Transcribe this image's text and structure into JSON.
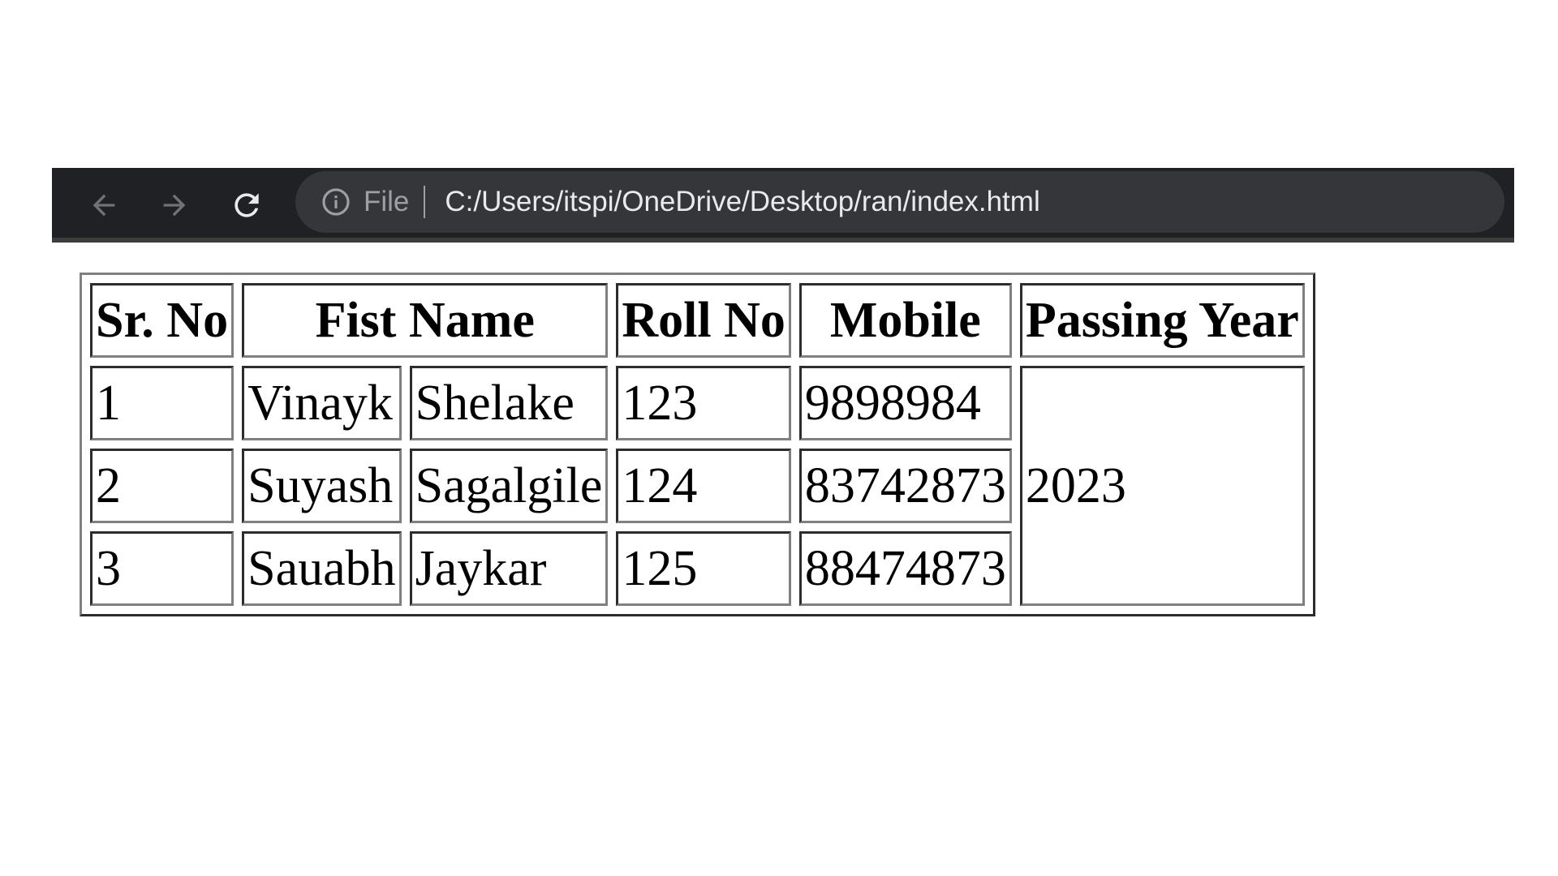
{
  "browser": {
    "back_icon": "arrow-left-icon",
    "forward_icon": "arrow-right-icon",
    "reload_icon": "reload-icon",
    "info_icon": "info-icon",
    "file_label": "File",
    "url": "C:/Users/itspi/OneDrive/Desktop/ran/index.html"
  },
  "table": {
    "headers": {
      "sr_no": "Sr. No",
      "first_name": "Fist Name",
      "roll_no": "Roll No",
      "mobile": "Mobile",
      "passing_year": "Passing Year"
    },
    "rows": [
      {
        "sr_no": "1",
        "first": "Vinayk",
        "last": "Shelake",
        "roll_no": "123",
        "mobile": "9898984"
      },
      {
        "sr_no": "2",
        "first": "Suyash",
        "last": "Sagalgile",
        "roll_no": "124",
        "mobile": "83742873"
      },
      {
        "sr_no": "3",
        "first": "Sauabh",
        "last": "Jaykar",
        "roll_no": "125",
        "mobile": "88474873"
      }
    ],
    "passing_year": "2023"
  }
}
